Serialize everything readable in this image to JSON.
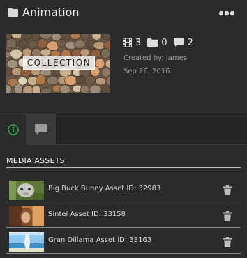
{
  "header": {
    "title": "Animation",
    "icon": "folder-icon",
    "more_icon": "more-dots-icon"
  },
  "collection": {
    "thumbnail_label": "COLLECTION",
    "stats": {
      "videos": "3",
      "folders": "0",
      "comments": "2"
    },
    "created_by": "Created by: James",
    "date": "Sep 26, 2016"
  },
  "tabs": [
    {
      "name": "info",
      "icon": "info-icon",
      "active": true
    },
    {
      "name": "comments",
      "icon": "comment-icon",
      "active": false
    }
  ],
  "media_assets": {
    "section_title": "MEDIA ASSETS",
    "items": [
      {
        "label": "Big Buck Bunny Asset ID: 32983"
      },
      {
        "label": "Sintel Asset ID: 33158"
      },
      {
        "label": "Gran Dillama Asset ID: 33163"
      }
    ]
  },
  "colors": {
    "background": "#2b2b2b",
    "accent": "#2ea44f",
    "text": "#e6e6e6",
    "muted": "#9a9a9a"
  }
}
